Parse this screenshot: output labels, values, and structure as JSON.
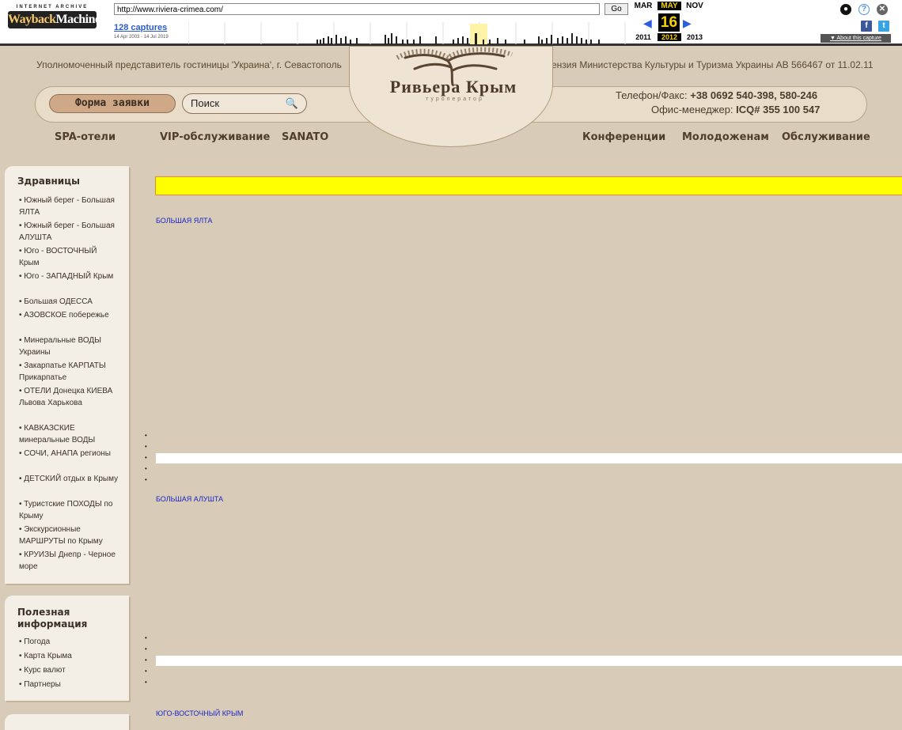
{
  "wayback": {
    "logo_line1": "INTERNET ARCHIVE",
    "logo_word1": "Wayback",
    "logo_word2": "Machine",
    "url": "http://www.riviera-crimea.com/",
    "go_label": "Go",
    "captures_label": "128 captures",
    "date_range": "14 Apr 2003 - 14 Jul 2019",
    "months": {
      "prev": "MAR",
      "current": "MAY",
      "next": "NOV"
    },
    "day": "16",
    "years": {
      "prev": "2011",
      "current": "2012",
      "next": "2013"
    },
    "about_label": "▼ About this capture",
    "icons": [
      "user-icon",
      "help-icon",
      "close-icon",
      "facebook-icon",
      "twitter-icon"
    ]
  },
  "header": {
    "representative_text": "Уполномоченный представитель гостиницы 'Украина', г. Севастополь",
    "license_text": "ензия Министерства Культуры и Туризма Украины АВ 566467 от 11.02.11",
    "brand": "Ривьера Крым",
    "tagline": "туроператор",
    "order_button": "Форма заявки",
    "search_placeholder": "Поиск",
    "phone_label": "Телефон/Факс:",
    "phone_value": "+38 0692 540-398, 580-246",
    "office_label": "Офис-менеджер:",
    "office_value": "ICQ# 355 100 547"
  },
  "nav": [
    {
      "label": "SPA-отели"
    },
    {
      "label": "VIP-обслуживание"
    },
    {
      "label": "SANATO"
    },
    {
      "label": "Конференции"
    },
    {
      "label": "Молодоженам"
    },
    {
      "label": "Обслуживание"
    }
  ],
  "sidebar": {
    "health_title": "Здравницы",
    "health_items": [
      "• Южный берег - Большая ЯЛТА",
      "• Южный берег - Большая АЛУШТА",
      "• Юго - ВОСТОЧНЫЙ Крым",
      "• Юго - ЗАПАДНЫЙ Крым",
      "• Большая ОДЕССА",
      "• АЗОВСКОЕ побережье",
      "• Минеральные ВОДЫ Украины",
      "• Закарпатье КАРПАТЫ Прикарпатье",
      "• ОТЕЛИ Донецка КИЕВА Львова Харькова",
      "• КАВКАЗСКИЕ минеральные ВОДЫ",
      "• СОЧИ, АНАПА регионы",
      "• ДЕТСКИЙ отдых в Крыму",
      "• Туристские ПОХОДЫ по Крыму",
      "• Экскурсионные МАРШРУТЫ по Крыму",
      "• КРУИЗЫ Днепр - Черное море"
    ],
    "info_title": "Полезная информация",
    "info_items": [
      "• Погода",
      "• Карта Крыма",
      "• Курс валют",
      "• Партнеры"
    ]
  },
  "main": {
    "regions": [
      "БОЛЬШАЯ ЯЛТА",
      "БОЛЬШАЯ АЛУШТА",
      "ЮГО-ВОСТОЧНЫЙ КРЫМ"
    ],
    "bullet": "•"
  },
  "colors": {
    "page_bg": "#d8cbb7",
    "highlight": "#ffff00",
    "link": "#1a24c8",
    "wayback_accent": "#f7d200"
  }
}
